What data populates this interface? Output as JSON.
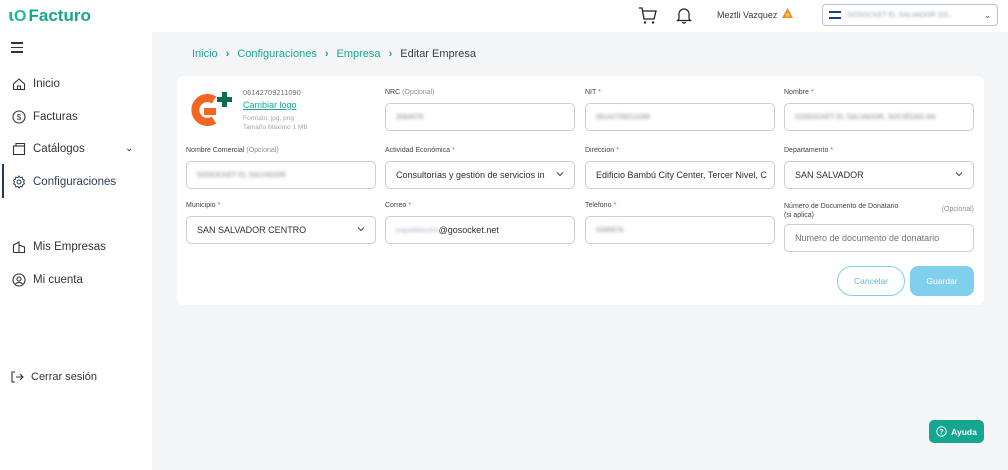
{
  "app": {
    "logo_mark": "ꙇO",
    "logo_text": "Facturo"
  },
  "header": {
    "user_name": "Meztli Vazquez",
    "company_selected": "GOSOCKET EL SALVADOR SO..."
  },
  "sidebar": {
    "items": [
      {
        "label": "Inicio",
        "icon": "home-icon"
      },
      {
        "label": "Facturas",
        "icon": "dollar-icon"
      },
      {
        "label": "Catálogos",
        "icon": "catalog-icon"
      },
      {
        "label": "Configuraciones",
        "icon": "gear-icon"
      },
      {
        "label": "Mis Empresas",
        "icon": "building-icon"
      },
      {
        "label": "Mi cuenta",
        "icon": "user-circle-icon"
      }
    ],
    "logout": "Cerrar sesión"
  },
  "breadcrumb": {
    "items": [
      "Inicio",
      "Configuraciones",
      "Empresa"
    ],
    "current": "Editar Empresa"
  },
  "logo_section": {
    "id": "06142709211090",
    "change_logo": "Cambiar logo",
    "format": "Formato: jpg, png",
    "max_size": "Tamaño Máximo 1 MB"
  },
  "form": {
    "nrc": {
      "label": "NRC",
      "hint": "(Opcional)",
      "value": "3084678"
    },
    "nit": {
      "label": "NIT",
      "value": "06142709211090"
    },
    "nombre": {
      "label": "Nombre",
      "value": "GOSOCKET EL SALVADOR, SOCIEDAD AN"
    },
    "nombre_comercial": {
      "label": "Nombre Comercial",
      "hint": "(Opcional)",
      "value": "GOSOCKET EL SALVADOR"
    },
    "actividad": {
      "label": "Actividad Económica",
      "value": "Consultorías y gestión de servicios in"
    },
    "direccion": {
      "label": "Direccion",
      "value": "Edificio Bambú City Center, Tercer Nivel, C"
    },
    "departamento": {
      "label": "Departamento",
      "value": "SAN SALVADOR"
    },
    "municipio": {
      "label": "Municipio",
      "value": "SAN SALVADOR CENTRO"
    },
    "correo": {
      "label": "Correo",
      "value_hidden": "pagodelasutna",
      "value_domain": "@gosocket.net"
    },
    "telefono": {
      "label": "Telefono",
      "value": "5346678"
    },
    "donatario": {
      "label": "Número de Documento de Donatario (si aplica)",
      "hint": "(Opcional)",
      "placeholder": "Numero de documento de donatario"
    }
  },
  "buttons": {
    "cancel": "Cancelar",
    "save": "Guardar",
    "help": "Ayuda"
  },
  "colors": {
    "brand": "#16a58f",
    "save": "#80cfec",
    "required": "#e05050"
  }
}
